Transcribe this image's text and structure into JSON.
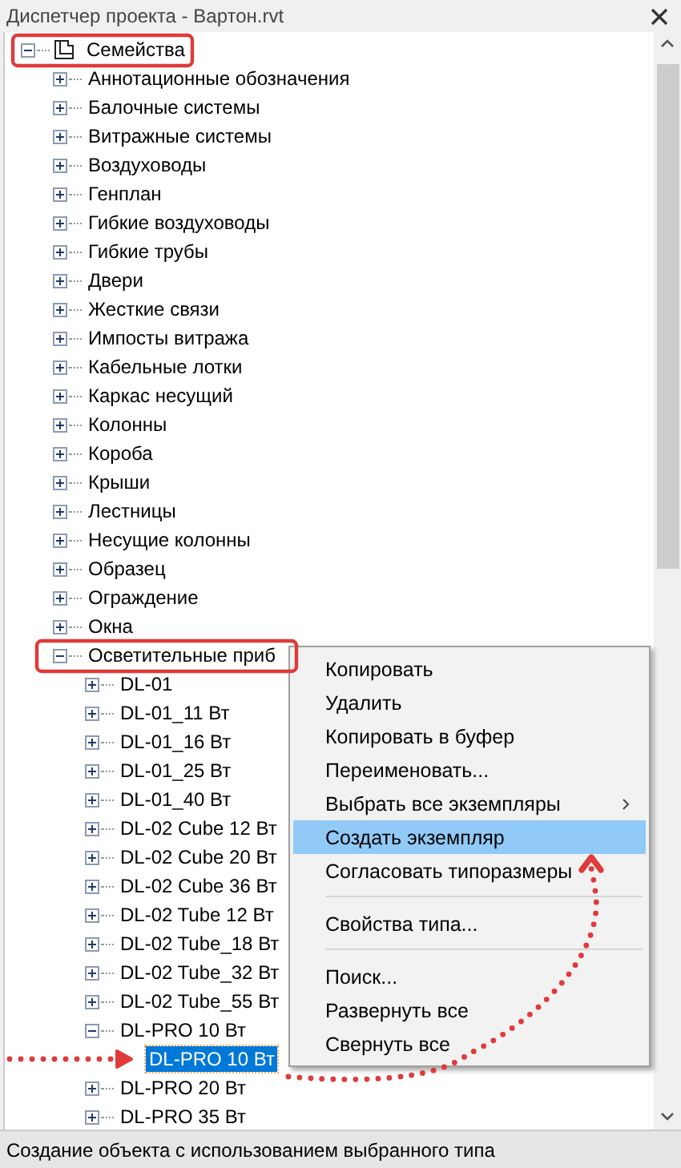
{
  "window": {
    "title": "Диспетчер проекта - Вартон.rvt"
  },
  "tree": [
    {
      "label": "Семейства",
      "kind": "family",
      "expanded": true,
      "selected": false,
      "children": [
        {
          "label": "Аннотационные обозначения",
          "kind": "branch",
          "expanded": false,
          "selected": false
        },
        {
          "label": "Балочные системы",
          "kind": "branch",
          "expanded": false,
          "selected": false
        },
        {
          "label": "Витражные системы",
          "kind": "branch",
          "expanded": false,
          "selected": false
        },
        {
          "label": "Воздуховоды",
          "kind": "branch",
          "expanded": false,
          "selected": false
        },
        {
          "label": "Генплан",
          "kind": "branch",
          "expanded": false,
          "selected": false
        },
        {
          "label": "Гибкие воздуховоды",
          "kind": "branch",
          "expanded": false,
          "selected": false
        },
        {
          "label": "Гибкие трубы",
          "kind": "branch",
          "expanded": false,
          "selected": false
        },
        {
          "label": "Двери",
          "kind": "branch",
          "expanded": false,
          "selected": false
        },
        {
          "label": "Жесткие связи",
          "kind": "branch",
          "expanded": false,
          "selected": false
        },
        {
          "label": "Импосты витража",
          "kind": "branch",
          "expanded": false,
          "selected": false
        },
        {
          "label": "Кабельные лотки",
          "kind": "branch",
          "expanded": false,
          "selected": false
        },
        {
          "label": "Каркас несущий",
          "kind": "branch",
          "expanded": false,
          "selected": false
        },
        {
          "label": "Колонны",
          "kind": "branch",
          "expanded": false,
          "selected": false
        },
        {
          "label": "Короба",
          "kind": "branch",
          "expanded": false,
          "selected": false
        },
        {
          "label": "Крыши",
          "kind": "branch",
          "expanded": false,
          "selected": false
        },
        {
          "label": "Лестницы",
          "kind": "branch",
          "expanded": false,
          "selected": false
        },
        {
          "label": "Несущие колонны",
          "kind": "branch",
          "expanded": false,
          "selected": false
        },
        {
          "label": "Образец",
          "kind": "branch",
          "expanded": false,
          "selected": false
        },
        {
          "label": "Ограждение",
          "kind": "branch",
          "expanded": false,
          "selected": false
        },
        {
          "label": "Окна",
          "kind": "branch",
          "expanded": false,
          "selected": false
        },
        {
          "label": "Осветительные приб",
          "kind": "branch",
          "expanded": true,
          "selected": false,
          "children": [
            {
              "label": "DL-01",
              "kind": "branch",
              "expanded": false,
              "selected": false
            },
            {
              "label": "DL-01_11 Вт",
              "kind": "branch",
              "expanded": false,
              "selected": false
            },
            {
              "label": "DL-01_16 Вт",
              "kind": "branch",
              "expanded": false,
              "selected": false
            },
            {
              "label": "DL-01_25 Вт",
              "kind": "branch",
              "expanded": false,
              "selected": false
            },
            {
              "label": "DL-01_40 Вт",
              "kind": "branch",
              "expanded": false,
              "selected": false
            },
            {
              "label": "DL-02 Cube 12 Вт",
              "kind": "branch",
              "expanded": false,
              "selected": false
            },
            {
              "label": "DL-02 Cube 20 Вт",
              "kind": "branch",
              "expanded": false,
              "selected": false
            },
            {
              "label": "DL-02 Cube 36 Вт",
              "kind": "branch",
              "expanded": false,
              "selected": false
            },
            {
              "label": "DL-02 Tube 12 Вт",
              "kind": "branch",
              "expanded": false,
              "selected": false
            },
            {
              "label": "DL-02 Tube_18 Вт",
              "kind": "branch",
              "expanded": false,
              "selected": false
            },
            {
              "label": "DL-02 Tube_32 Вт",
              "kind": "branch",
              "expanded": false,
              "selected": false
            },
            {
              "label": "DL-02 Tube_55 Вт",
              "kind": "branch",
              "expanded": false,
              "selected": false
            },
            {
              "label": "DL-PRO 10 Вт",
              "kind": "branch",
              "expanded": true,
              "selected": false,
              "children": [
                {
                  "label": "DL-PRO 10 Вт",
                  "kind": "leaf",
                  "selected": true
                }
              ]
            },
            {
              "label": "DL-PRO 20 Вт",
              "kind": "branch",
              "expanded": false,
              "selected": false
            },
            {
              "label": "DL-PRO 35 Вт",
              "kind": "branch",
              "expanded": false,
              "selected": false
            }
          ]
        }
      ]
    }
  ],
  "context_menu": [
    {
      "label": "Копировать",
      "kind": "item",
      "selected": false
    },
    {
      "label": "Удалить",
      "kind": "item",
      "selected": false
    },
    {
      "label": "Копировать в буфер",
      "kind": "item",
      "selected": false
    },
    {
      "label": "Переименовать...",
      "kind": "item",
      "selected": false
    },
    {
      "label": "Выбрать все экземпляры",
      "kind": "submenu",
      "selected": false
    },
    {
      "label": "Создать экземпляр",
      "kind": "item",
      "selected": true
    },
    {
      "label": "Согласовать типоразмеры",
      "kind": "item",
      "selected": false
    },
    {
      "kind": "separator"
    },
    {
      "label": "Свойства типа...",
      "kind": "item",
      "selected": false
    },
    {
      "kind": "separator"
    },
    {
      "label": "Поиск...",
      "kind": "item",
      "selected": false
    },
    {
      "label": "Развернуть все",
      "kind": "item",
      "selected": false
    },
    {
      "label": "Свернуть все",
      "kind": "item",
      "selected": false
    }
  ],
  "status_bar": "Создание объекта с использованием выбранного типа"
}
